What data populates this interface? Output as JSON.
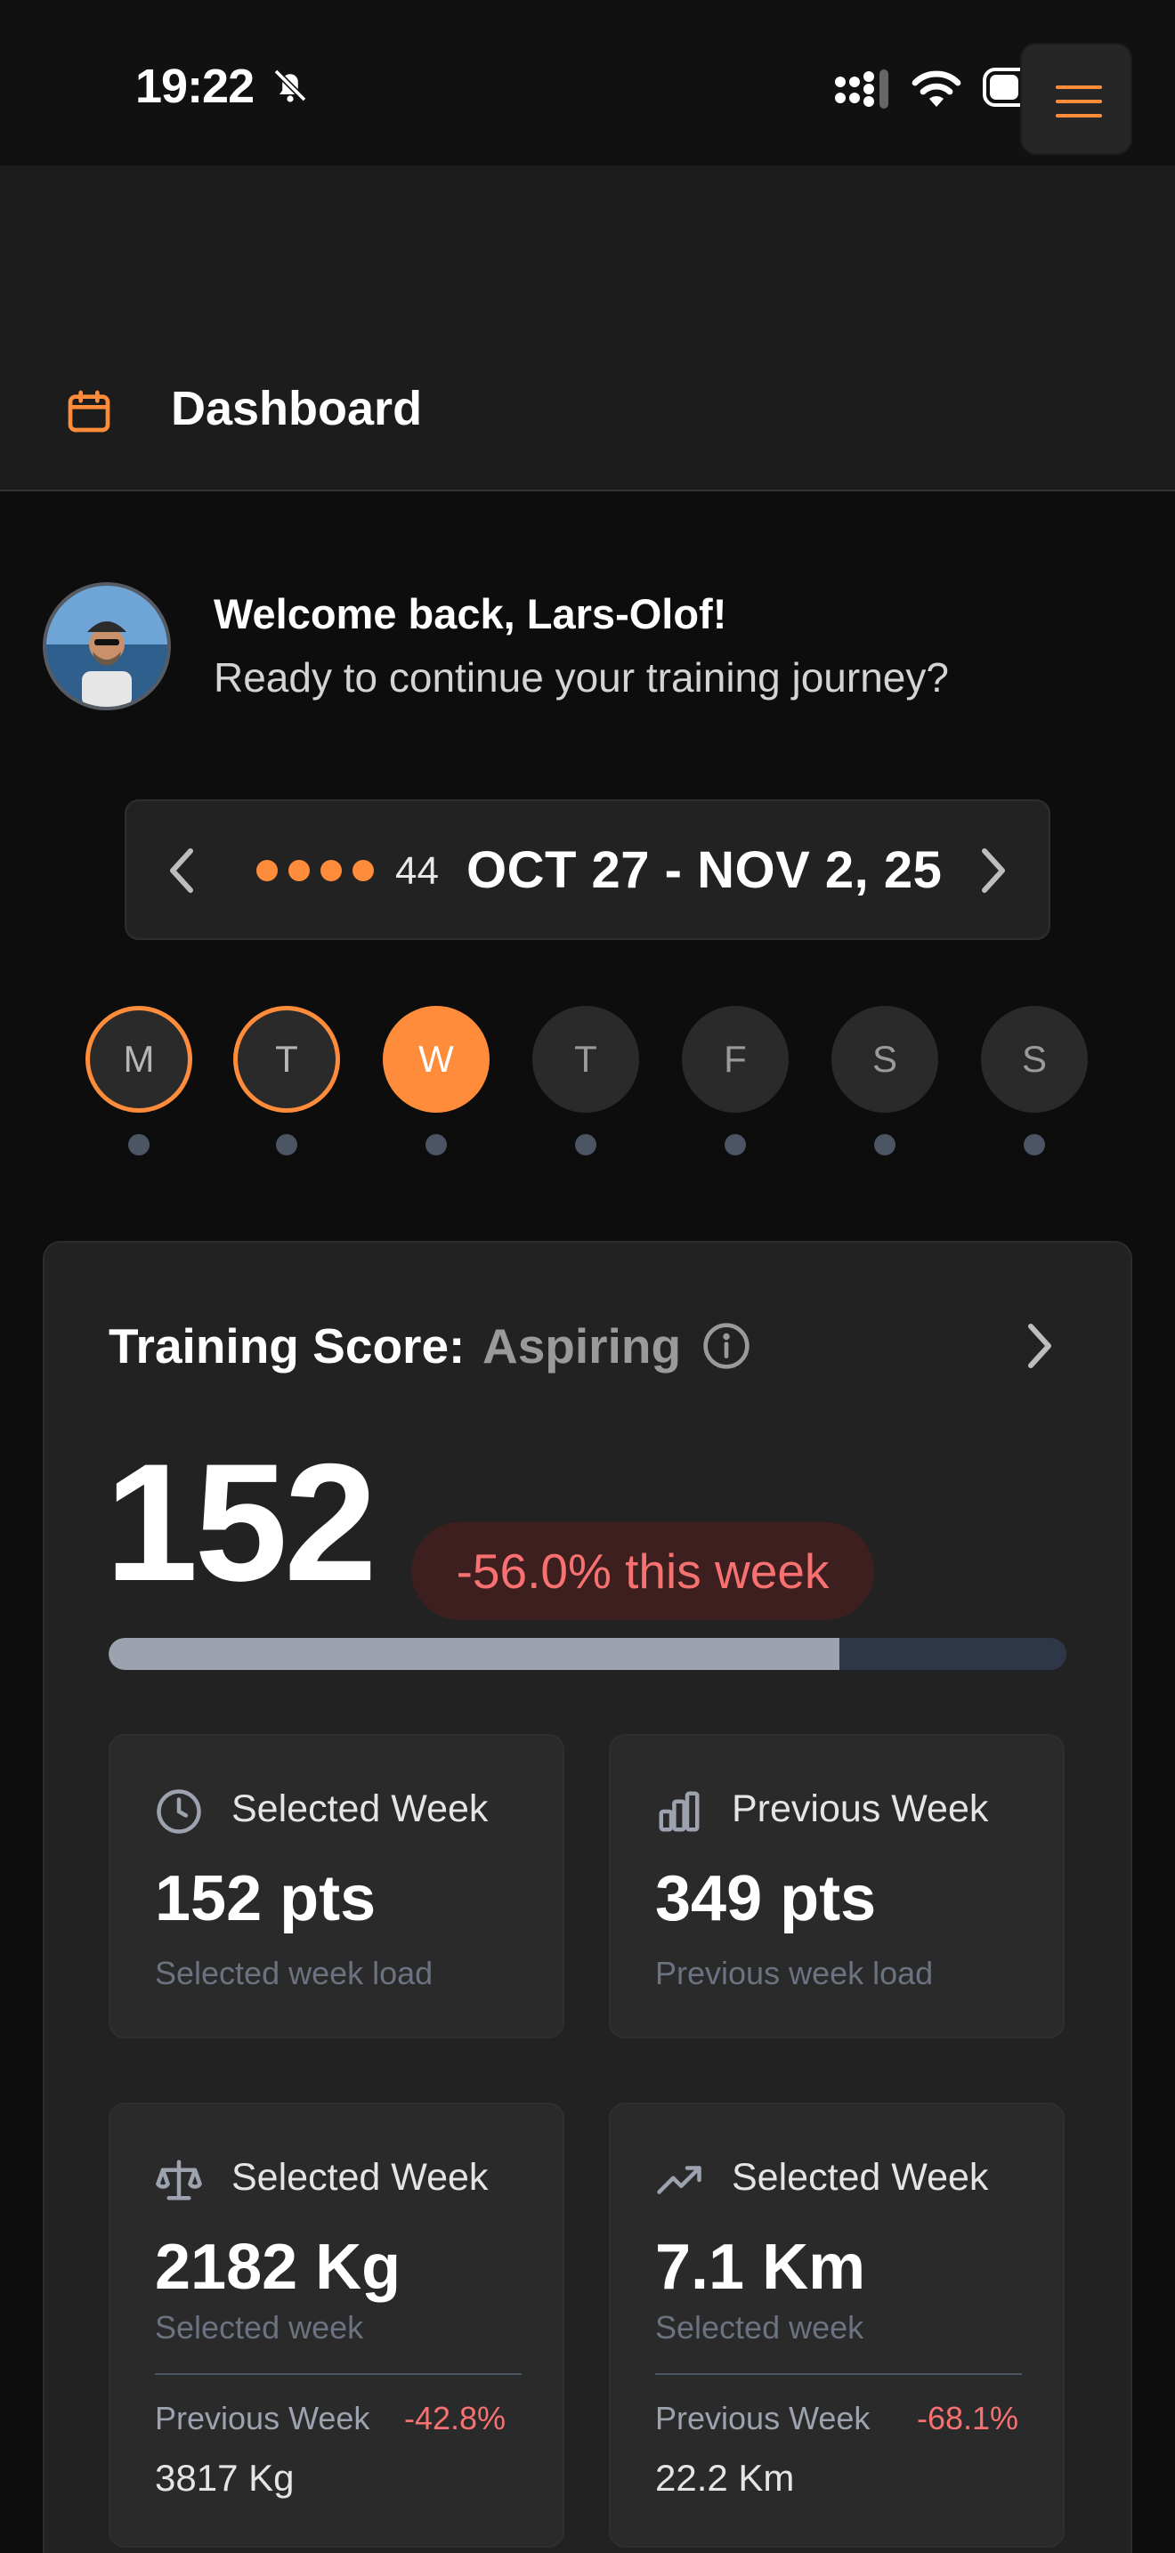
{
  "status_bar": {
    "time": "19:22"
  },
  "header": {
    "title": "Dashboard"
  },
  "welcome": {
    "title": "Welcome back, Lars-Olof!",
    "subtitle": "Ready to continue your training journey?"
  },
  "week": {
    "number": "44",
    "range": "OCT 27 - NOV 2, 25",
    "dots": 4
  },
  "days": [
    {
      "label": "M",
      "state": "done"
    },
    {
      "label": "T",
      "state": "done"
    },
    {
      "label": "W",
      "state": "active"
    },
    {
      "label": "T",
      "state": "none"
    },
    {
      "label": "F",
      "state": "none"
    },
    {
      "label": "S",
      "state": "none"
    },
    {
      "label": "S",
      "state": "none"
    }
  ],
  "score": {
    "label": "Training Score:",
    "level": "Aspiring",
    "value": "152",
    "change": "-56.0% this week",
    "progress_fraction": 0.763
  },
  "stats": {
    "selected_load": {
      "title": "Selected Week",
      "value": "152 pts",
      "sub": "Selected week load",
      "icon": "clock-icon"
    },
    "previous_load": {
      "title": "Previous Week",
      "value": "349 pts",
      "sub": "Previous week load",
      "icon": "bar-chart-icon"
    },
    "weight": {
      "title": "Selected Week",
      "value": "2182 Kg",
      "sub": "Selected week",
      "prev_label": "Previous Week",
      "prev_change": "-42.8%",
      "prev_value": "3817 Kg",
      "icon": "scale-icon"
    },
    "distance": {
      "title": "Selected Week",
      "value": "7.1 Km",
      "sub": "Selected week",
      "prev_label": "Previous Week",
      "prev_change": "-68.1%",
      "prev_value": "22.2 Km",
      "icon": "trending-up-icon"
    }
  },
  "colors": {
    "accent": "#ff8c3a",
    "negative": "#f87171",
    "card": "#222222",
    "background": "#0d0d0d"
  }
}
